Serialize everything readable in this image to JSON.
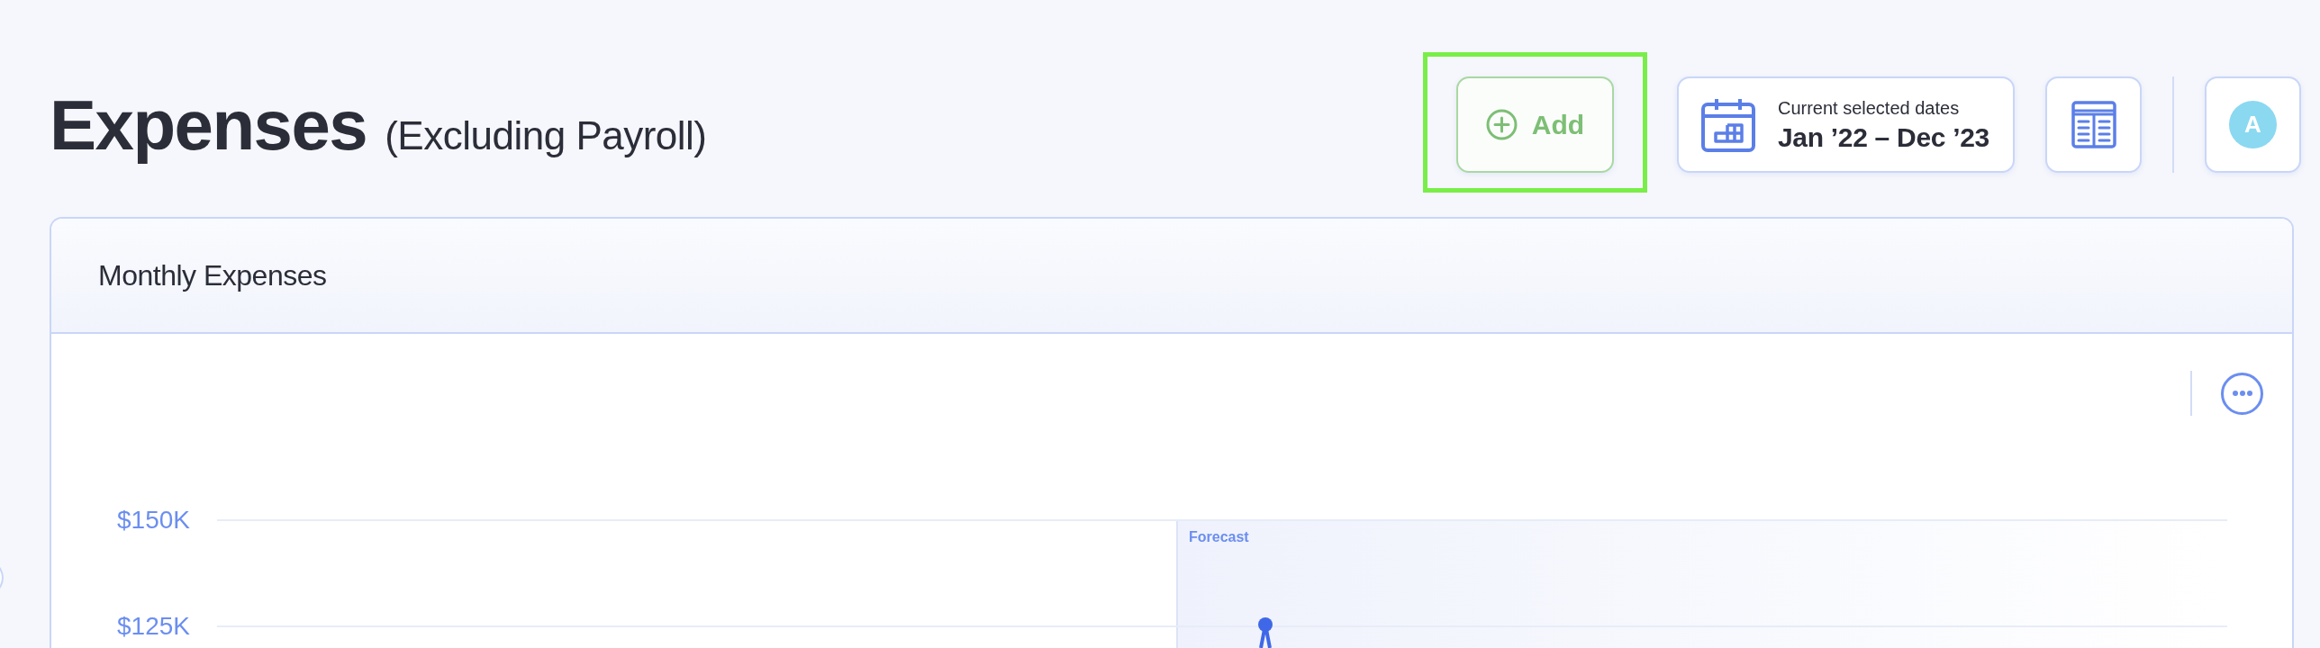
{
  "header": {
    "title": "Expenses",
    "subtitle": "(Excluding Payroll)"
  },
  "actions": {
    "add_button": {
      "label": "Add",
      "highlighted": true
    },
    "date_range": {
      "caption": "Current selected dates",
      "value": "Jan ’22 – Dec ’23"
    },
    "avatar": {
      "initial": "A"
    }
  },
  "card": {
    "title": "Monthly Expenses",
    "chart": {
      "y_axis_labels": [
        "$150K",
        "$125K"
      ],
      "forecast_label": "Forecast"
    }
  }
}
